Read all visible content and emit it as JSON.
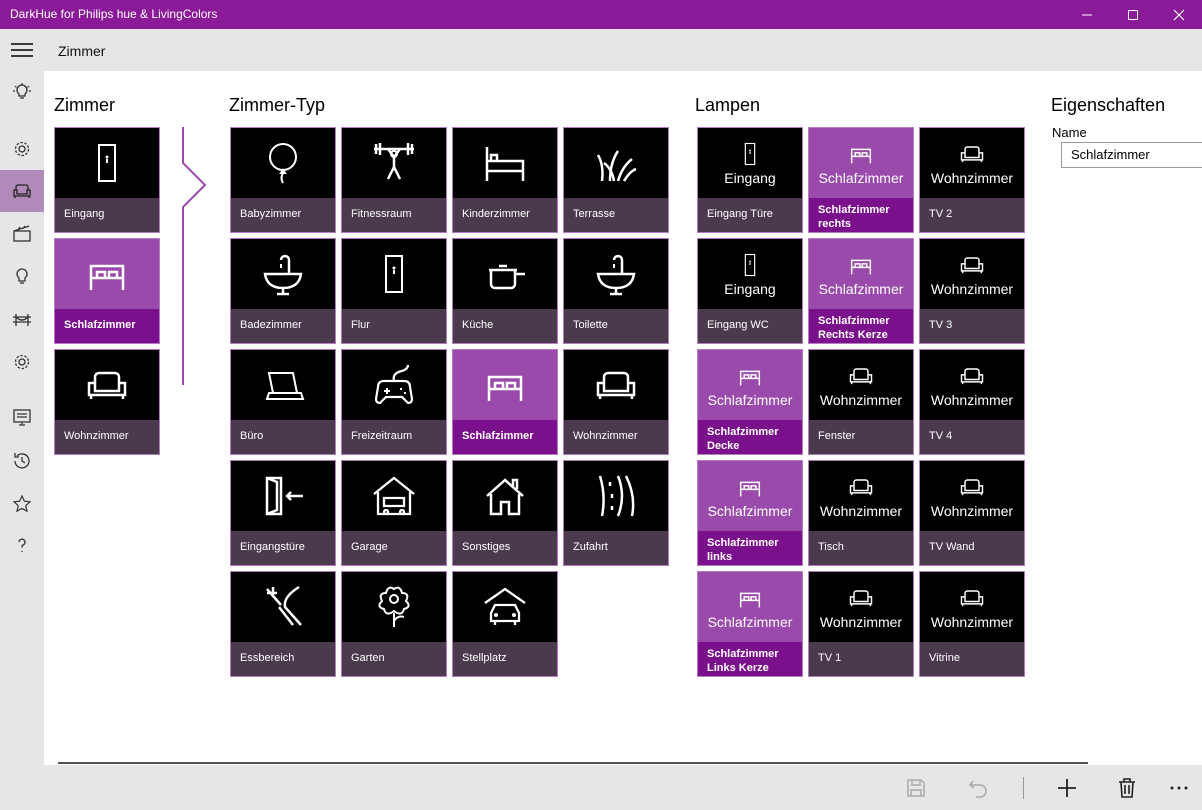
{
  "window": {
    "title": "DarkHue for Philips hue & LivingColors"
  },
  "header": {
    "title": "Zimmer"
  },
  "nav_icons": [
    "bulb-icon",
    "settings-icon",
    "sofa-icon",
    "scene-icon",
    "lamp-icon",
    "bridge-icon",
    "gear-icon",
    "schedule-icon",
    "history-icon",
    "star-icon",
    "help-icon"
  ],
  "sections": {
    "zimmer": "Zimmer",
    "zimmer_typ": "Zimmer-Typ",
    "lampen": "Lampen",
    "eigenschaften": "Eigenschaften"
  },
  "rooms": [
    {
      "label": "Eingang",
      "icon": "door-icon",
      "selected": false
    },
    {
      "label": "Schlafzimmer",
      "icon": "bed-icon",
      "selected": true
    },
    {
      "label": "Wohnzimmer",
      "icon": "sofa-icon",
      "selected": false
    }
  ],
  "room_types": [
    {
      "label": "Babyzimmer",
      "icon": "balloon-icon"
    },
    {
      "label": "Fitnessraum",
      "icon": "weightlifter-icon"
    },
    {
      "label": "Kinderzimmer",
      "icon": "bed-icon"
    },
    {
      "label": "Terrasse",
      "icon": "grass-icon"
    },
    {
      "label": "Badezimmer",
      "icon": "sink-icon"
    },
    {
      "label": "Flur",
      "icon": "door-icon"
    },
    {
      "label": "Küche",
      "icon": "pot-icon"
    },
    {
      "label": "Toilette",
      "icon": "sink-icon"
    },
    {
      "label": "Büro",
      "icon": "laptop-icon"
    },
    {
      "label": "Freizeitraum",
      "icon": "gamepad-icon"
    },
    {
      "label": "Schlafzimmer",
      "icon": "double-bed-icon",
      "selected": true
    },
    {
      "label": "Wohnzimmer",
      "icon": "sofa-icon"
    },
    {
      "label": "Eingangstüre",
      "icon": "entrance-icon"
    },
    {
      "label": "Garage",
      "icon": "garage-icon"
    },
    {
      "label": "Sonstiges",
      "icon": "house-icon"
    },
    {
      "label": "Zufahrt",
      "icon": "road-icon"
    },
    {
      "label": "Essbereich",
      "icon": "cutlery-icon"
    },
    {
      "label": "Garten",
      "icon": "flower-icon"
    },
    {
      "label": "Stellplatz",
      "icon": "carport-icon"
    }
  ],
  "lamps": [
    {
      "room": "Eingang",
      "label": "Eingang Türe",
      "icon": "door-icon",
      "selected": false
    },
    {
      "room": "Schlafzimmer",
      "label": "Schlafzimmer rechts",
      "icon": "bed-icon",
      "selected": true
    },
    {
      "room": "Wohnzimmer",
      "label": "TV 2",
      "icon": "sofa-icon",
      "selected": false
    },
    {
      "room": "Eingang",
      "label": "Eingang WC",
      "icon": "door-icon",
      "selected": false
    },
    {
      "room": "Schlafzimmer",
      "label": "Schlafzimmer Rechts Kerze",
      "icon": "bed-icon",
      "selected": true
    },
    {
      "room": "Wohnzimmer",
      "label": "TV 3",
      "icon": "sofa-icon",
      "selected": false
    },
    {
      "room": "Schlafzimmer",
      "label": "Schlafzimmer Decke",
      "icon": "bed-icon",
      "selected": true
    },
    {
      "room": "Wohnzimmer",
      "label": "Fenster",
      "icon": "sofa-icon",
      "selected": false
    },
    {
      "room": "Wohnzimmer",
      "label": "TV 4",
      "icon": "sofa-icon",
      "selected": false
    },
    {
      "room": "Schlafzimmer",
      "label": "Schlafzimmer links",
      "icon": "bed-icon",
      "selected": true
    },
    {
      "room": "Wohnzimmer",
      "label": "Tisch",
      "icon": "sofa-icon",
      "selected": false
    },
    {
      "room": "Wohnzimmer",
      "label": "TV Wand",
      "icon": "sofa-icon",
      "selected": false
    },
    {
      "room": "Schlafzimmer",
      "label": "Schlafzimmer Links Kerze",
      "icon": "bed-icon",
      "selected": true
    },
    {
      "room": "Wohnzimmer",
      "label": "TV 1",
      "icon": "sofa-icon",
      "selected": false
    },
    {
      "room": "Wohnzimmer",
      "label": "Vitrine",
      "icon": "sofa-icon",
      "selected": false
    }
  ],
  "properties": {
    "name_label": "Name",
    "name_value": "Schlafzimmer"
  },
  "appbar_icons": [
    "save-icon",
    "undo-icon",
    "add-icon",
    "delete-icon",
    "more-icon"
  ],
  "colors": {
    "accent": "#8b1a99",
    "tile_selected": "#9a4aab",
    "label_selected": "#7b108c",
    "label_normal": "#4b3a4e"
  }
}
